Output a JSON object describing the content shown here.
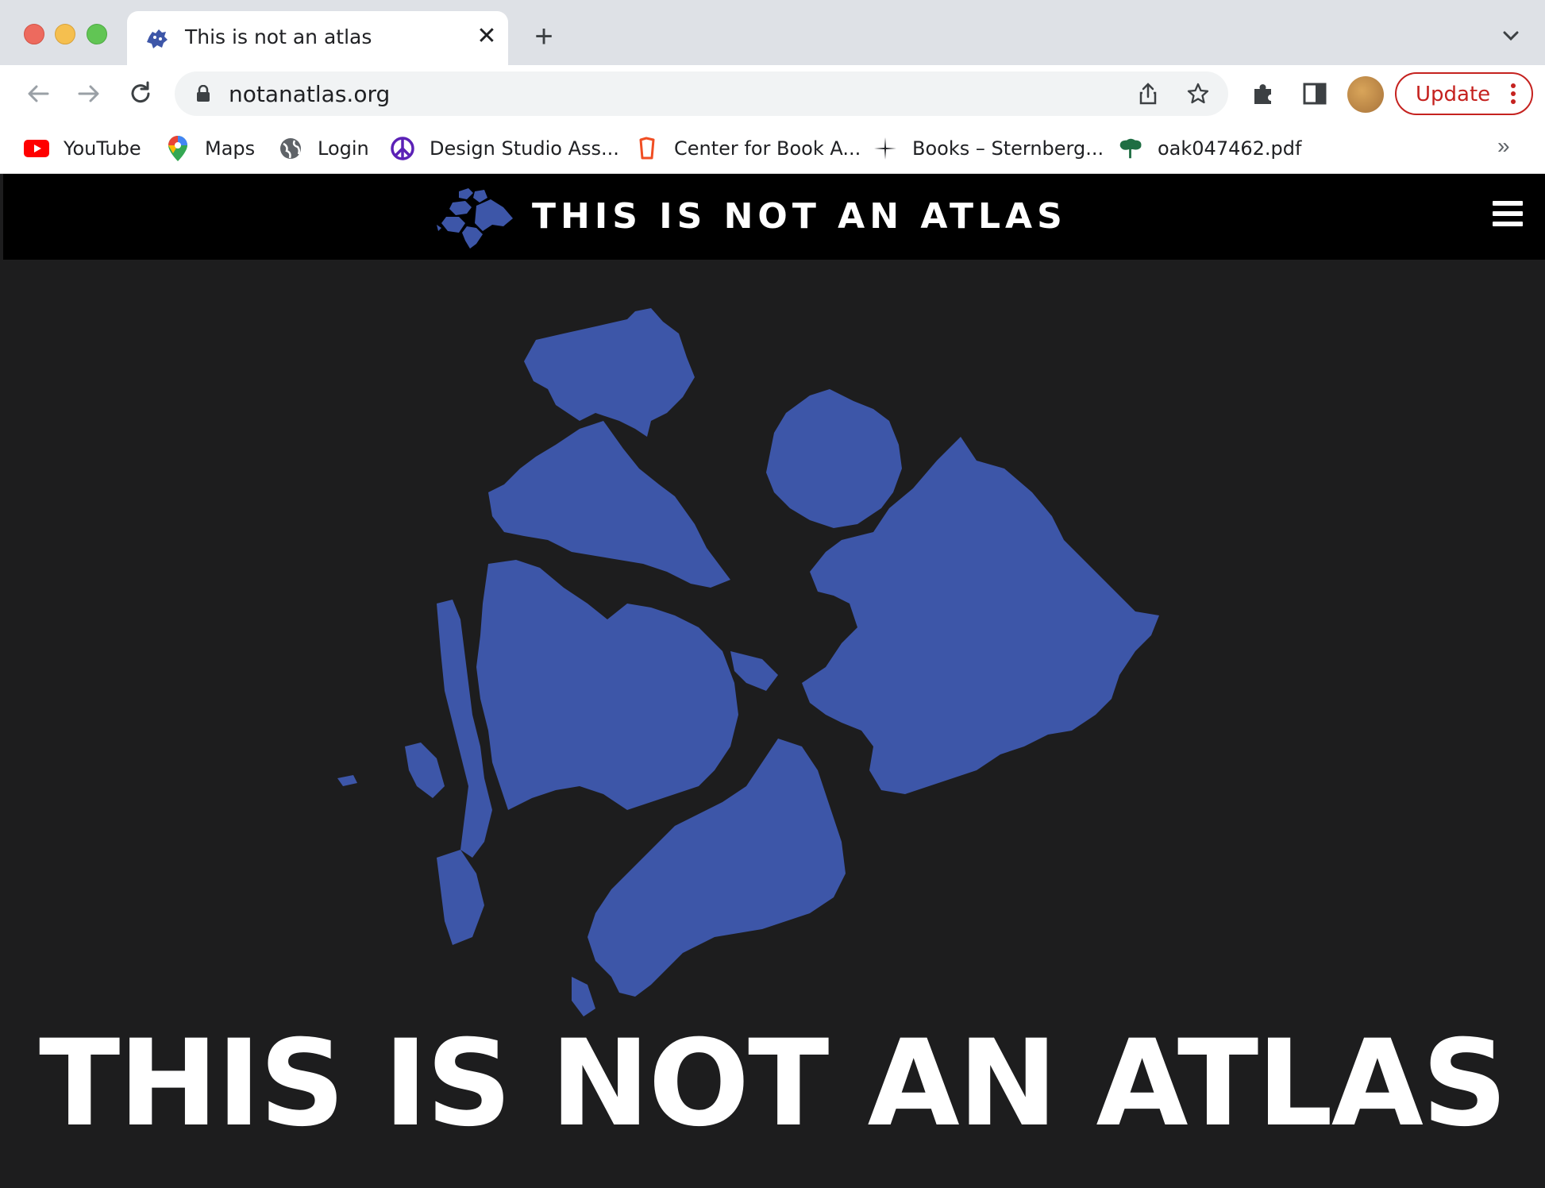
{
  "browser": {
    "tab": {
      "title": "This is not an atlas",
      "favicon": "atlas-favicon-icon"
    },
    "new_tab_symbol": "+",
    "close_symbol": "✕",
    "address_bar": {
      "url": "notanatlas.org",
      "secure_icon": "lock-icon"
    },
    "update_label": "Update",
    "colors": {
      "update_accent": "#c5221f",
      "tab_strip": "#dee1e6"
    }
  },
  "bookmarks": {
    "items": [
      {
        "label": "YouTube",
        "icon": "youtube-icon"
      },
      {
        "label": "Maps",
        "icon": "google-maps-icon"
      },
      {
        "label": "Login",
        "icon": "globe-icon"
      },
      {
        "label": "Design Studio Ass...",
        "icon": "peace-sign-icon"
      },
      {
        "label": "Center for Book A...",
        "icon": "bookmark-favicon-icon"
      },
      {
        "label": "Books – Sternberg...",
        "icon": "sparkle-icon"
      },
      {
        "label": "oak047462.pdf",
        "icon": "tree-icon"
      }
    ],
    "overflow_symbol": "»"
  },
  "site": {
    "header_title": "THIS IS NOT AN ATLAS",
    "hero_title": "THIS IS NOT AN ATLAS",
    "colors": {
      "map_blue": "#3d56a8",
      "background": "#1d1d1e",
      "header": "#000000"
    }
  }
}
